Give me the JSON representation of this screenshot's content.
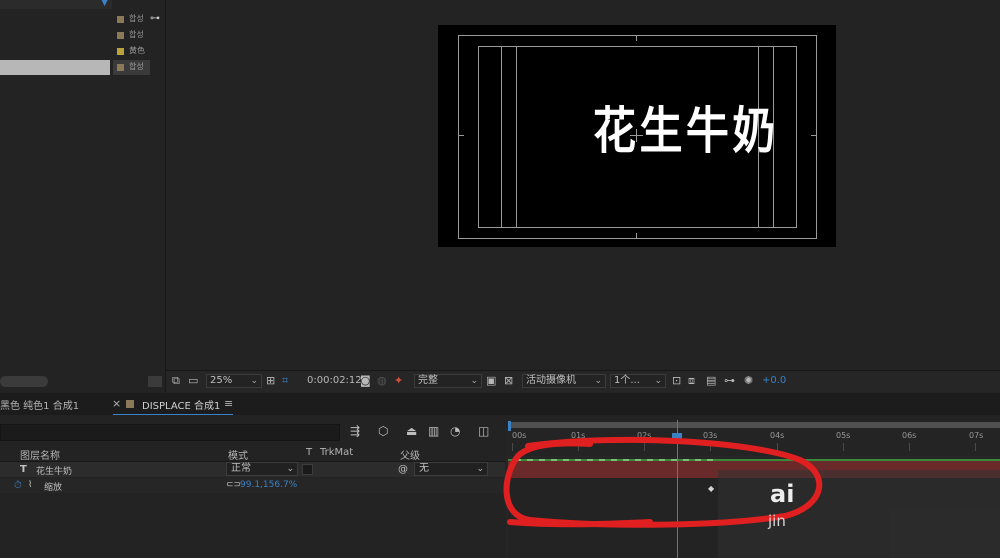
{
  "project_panel": {
    "items": [
      {
        "tag": "합성",
        "swatch": "#8a7a5a",
        "selected": false
      },
      {
        "tag": "합성",
        "swatch": "#8a7a5a",
        "selected": false
      },
      {
        "tag": "黄色",
        "swatch": "#b8a43a",
        "selected": false
      },
      {
        "tag": "합성",
        "swatch": "#8a7a5a",
        "selected": true
      }
    ]
  },
  "composition": {
    "text": "花生牛奶"
  },
  "viewer_toolbar": {
    "zoom": "25%",
    "timecode": "0:00:02:12",
    "resolution": "完整",
    "camera": "活动摄像机",
    "views": "1个...",
    "exposure": "+0.0"
  },
  "tabs": {
    "tab1": "黑色 纯色1 合成1",
    "close_glyph": "×",
    "tab2": "DISPLACE 合成1",
    "menu_glyph": "≡"
  },
  "timeline": {
    "columns": {
      "layer_name": "图层名称",
      "mode": "模式",
      "t": "T",
      "trkmat": "TrkMat",
      "parent": "父级"
    },
    "layer": {
      "type_glyph": "T",
      "name": "花生牛奶",
      "mode": "正常",
      "parent": "无"
    },
    "property": {
      "name": "缩放",
      "value": "99.1,156.7%"
    },
    "ruler": [
      "00s",
      "01s",
      "02s",
      "03s",
      "04s",
      "05s",
      "06s",
      "07s"
    ]
  },
  "annotation_color": "#e02020",
  "watermark": {
    "main": "ai",
    "sub": "jin"
  }
}
